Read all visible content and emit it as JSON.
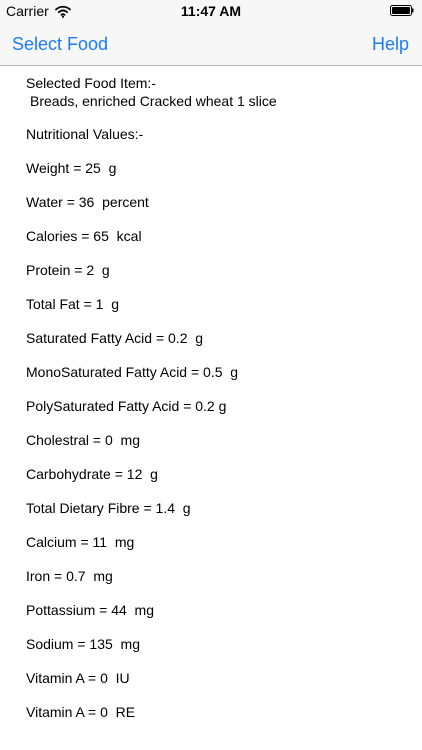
{
  "status_bar": {
    "carrier": "Carrier",
    "time": "11:47 AM"
  },
  "nav_bar": {
    "left_button": "Select Food",
    "right_button": "Help"
  },
  "content": {
    "selected_heading": "Selected Food Item:-",
    "selected_item": "Breads, enriched Cracked wheat 1 slice",
    "nutrition_heading": "Nutritional Values:-",
    "nutrients": [
      "Weight = 25  g",
      "Water = 36  percent",
      "Calories = 65  kcal",
      "Protein = 2  g",
      "Total Fat = 1  g",
      "Saturated Fatty Acid = 0.2  g",
      "MonoSaturated Fatty Acid = 0.5  g",
      "PolySaturated Fatty Acid = 0.2 g",
      "Cholestral = 0  mg",
      "Carbohydrate = 12  g",
      "Total Dietary Fibre = 1.4  g",
      "Calcium = 11  mg",
      "Iron = 0.7  mg",
      "Pottassium = 44  mg",
      "Sodium = 135  mg",
      "Vitamin A = 0  IU",
      "Vitamin A = 0  RE"
    ]
  }
}
